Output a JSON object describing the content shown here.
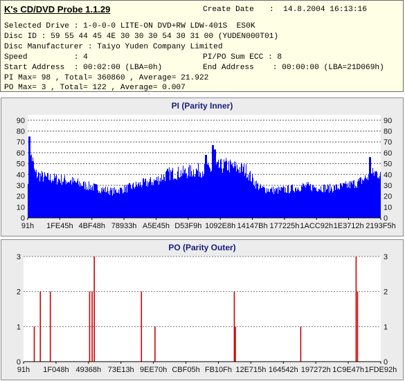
{
  "app_title": "K's CD/DVD Probe 1.1.29",
  "info": {
    "create_date_label": "Create Date",
    "create_date_value": ":  14.8.2004 16:13:16",
    "selected_drive": "Selected Drive : 1-0-0-0 LITE-ON DVD+RW LDW-401S  ES0K",
    "disc_id": "Disc ID : 59 55 44 45 4E 30 30 30 54 30 31 00 (YUDEN000T01)",
    "disc_manufacturer": "Disc Manufacturer : Taiyo Yuden Company Limited",
    "speed": "Speed          : 4",
    "pipo_sum": "PI/PO Sum ECC : 8",
    "start_address": "Start Address  : 00:02:00 (LBA=0h)",
    "end_address": "End Address    : 00:00:00 (LBA=21D069h)",
    "pi_stats": "PI Max= 98 , Total= 360860 , Average= 21.922",
    "po_stats": "PO Max= 3 , Total= 122 , Average= 0.007"
  },
  "colors": {
    "pi_bars": "#0000ff",
    "po_bars": "#cc0000",
    "plot_bg": "#ffffff",
    "panel_bg": "#ececec",
    "title": "#1a1a80"
  },
  "chart_data": [
    {
      "type": "bar",
      "title": "PI (Parity Inner)",
      "ylim": [
        0,
        95
      ],
      "yticks": [
        0,
        10,
        20,
        30,
        40,
        50,
        60,
        70,
        80,
        90
      ],
      "xtick_labels": [
        "91h",
        "1FE45h",
        "4BF48h",
        "78933h",
        "A5E45h",
        "D53F9h",
        "1092E8h",
        "14147Bh",
        "177225h",
        "1ACC92h",
        "1E3712h",
        "2193F5h"
      ],
      "grid": true,
      "profile": [
        [
          0,
          38
        ],
        [
          0.01,
          60
        ],
        [
          0.02,
          42
        ],
        [
          0.05,
          38
        ],
        [
          0.08,
          37
        ],
        [
          0.12,
          35
        ],
        [
          0.16,
          31
        ],
        [
          0.2,
          28
        ],
        [
          0.24,
          25
        ],
        [
          0.28,
          28
        ],
        [
          0.32,
          32
        ],
        [
          0.36,
          35
        ],
        [
          0.4,
          42
        ],
        [
          0.44,
          43
        ],
        [
          0.48,
          45
        ],
        [
          0.52,
          46
        ],
        [
          0.56,
          50
        ],
        [
          0.6,
          47
        ],
        [
          0.62,
          45
        ],
        [
          0.64,
          35
        ],
        [
          0.66,
          28
        ],
        [
          0.7,
          26
        ],
        [
          0.74,
          27
        ],
        [
          0.78,
          30
        ],
        [
          0.82,
          29
        ],
        [
          0.86,
          28
        ],
        [
          0.9,
          30
        ],
        [
          0.94,
          34
        ],
        [
          0.97,
          40
        ],
        [
          0.985,
          43
        ],
        [
          1,
          42
        ]
      ],
      "spikes": [
        [
          0.004,
          75
        ],
        [
          0.525,
          67
        ],
        [
          0.53,
          63
        ],
        [
          0.505,
          58
        ],
        [
          0.97,
          56
        ]
      ]
    },
    {
      "type": "bar",
      "title": "PO (Parity Outer)",
      "ylim": [
        0,
        3
      ],
      "yticks": [
        0,
        1,
        2,
        3
      ],
      "xtick_labels": [
        "91h",
        "1F048h",
        "49368h",
        "73E13h",
        "9EE70h",
        "CBF05h",
        "FB10Fh",
        "12E715h",
        "164542h",
        "197272h",
        "1C9E47h",
        "1FDE92h"
      ],
      "grid": true,
      "points": [
        [
          0.03,
          1
        ],
        [
          0.047,
          2
        ],
        [
          0.075,
          2
        ],
        [
          0.185,
          2
        ],
        [
          0.192,
          2
        ],
        [
          0.198,
          3
        ],
        [
          0.33,
          2
        ],
        [
          0.368,
          1
        ],
        [
          0.59,
          2
        ],
        [
          0.593,
          1
        ],
        [
          0.776,
          1
        ],
        [
          0.931,
          3
        ],
        [
          0.935,
          2
        ]
      ]
    }
  ]
}
